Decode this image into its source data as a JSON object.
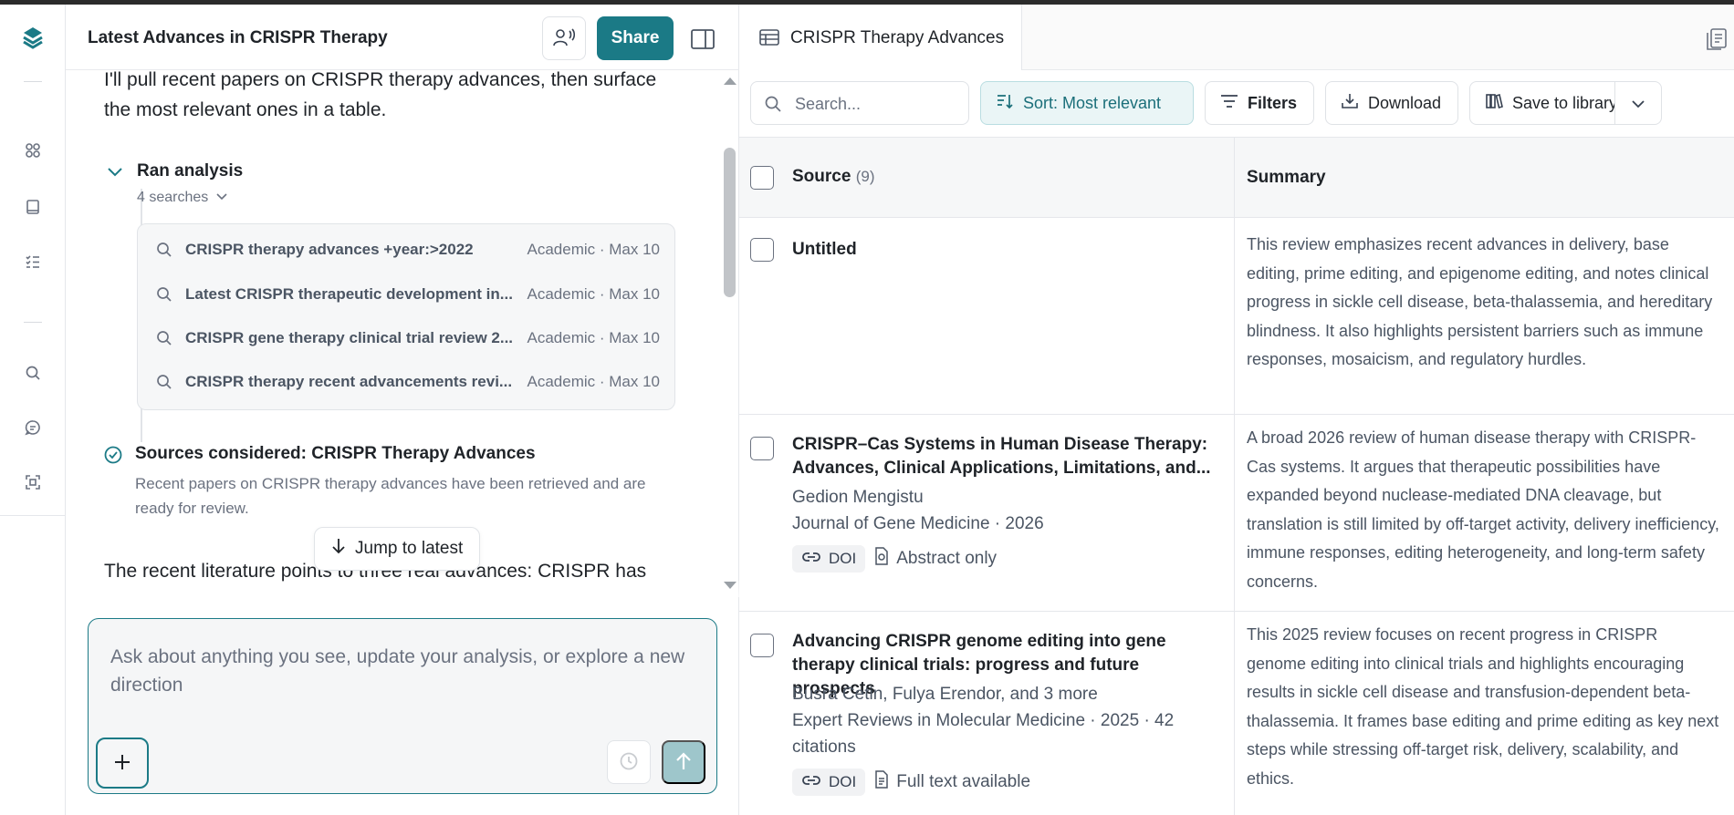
{
  "chat": {
    "title": "Latest Advances in CRISPR Therapy",
    "share_label": "Share",
    "intro": "I'll pull recent papers on CRISPR therapy advances, then surface the most relevant ones in a table.",
    "ran_label": "Ran analysis",
    "searches_label": "4 searches",
    "queries": [
      {
        "text": "CRISPR therapy advances +year:>2022",
        "meta": "Academic · Max 10"
      },
      {
        "text": "Latest CRISPR therapeutic development in...",
        "meta": "Academic · Max 10"
      },
      {
        "text": "CRISPR gene therapy clinical trial review 2...",
        "meta": "Academic · Max 10"
      },
      {
        "text": "CRISPR therapy recent advancements revi...",
        "meta": "Academic · Max 10"
      }
    ],
    "sources_title": "Sources considered: CRISPR Therapy Advances",
    "sources_desc": "Recent papers on CRISPR therapy advances have been retrieved and are ready for review.",
    "jump_label": "Jump to latest",
    "recent_text": "The recent literature points to three real advances: CRISPR has",
    "composer_placeholder": "Ask about anything you see, update your analysis, or explore a new direction"
  },
  "panel": {
    "tab_label": "CRISPR Therapy Advances",
    "search_placeholder": "Search...",
    "sort_label": "Sort: Most relevant",
    "filters_label": "Filters",
    "download_label": "Download",
    "save_label": "Save to library",
    "col_source": "Source",
    "col_source_count": "(9)",
    "col_summary": "Summary"
  },
  "rows": [
    {
      "title": "Untitled",
      "summary": "This review emphasizes recent advances in delivery, base editing, prime editing, and epigenome editing, and notes clinical progress in sickle cell disease, beta-thalassemia, and hereditary blindness. It also highlights persistent barriers such as immune responses, mosaicism, and regulatory hurdles."
    },
    {
      "title": "CRISPR–Cas Systems in Human Disease Therapy: Advances, Clinical Applications, Limitations, and...",
      "authors": "Gedion Mengistu",
      "venue": "Journal of Gene Medicine · 2026",
      "tag_doi": "DOI",
      "tag_access": "Abstract only",
      "summary": "A broad 2026 review of human disease therapy with CRISPR-Cas systems. It argues that therapeutic possibilities have expanded beyond nuclease-mediated DNA cleavage, but translation is still limited by off-target activity, delivery inefficiency, immune responses, editing heterogeneity, and long-term safety concerns."
    },
    {
      "title": "Advancing CRISPR genome editing into gene therapy clinical trials: progress and future prospects",
      "authors": "Busra Cetin, Fulya Erendor, and 3 more",
      "venue": "Expert Reviews in Molecular Medicine · 2025 · 42 citations",
      "tag_doi": "DOI",
      "tag_access": "Full text available",
      "summary": "This 2025 review focuses on recent progress in CRISPR genome editing into clinical trials and highlights encouraging results in sickle cell disease and transfusion-dependent beta-thalassemia. It frames base editing and prime editing as key next steps while stressing off-target risk, delivery, scalability, and ethics."
    }
  ],
  "colors": {
    "accent": "#1b7a86",
    "sort_bg": "#eaf5f6",
    "send_disabled": "#9ec6cb"
  },
  "icons": [
    "app-logo-icon",
    "grid-icon",
    "book-icon",
    "checklist-icon",
    "search-icon",
    "chat-icon",
    "scan-icon",
    "voice-icon",
    "panel-icon",
    "table-icon",
    "document-icon",
    "sort-icon",
    "filter-icon",
    "download-icon",
    "library-icon",
    "chevron-down-icon",
    "link-icon",
    "file-icon",
    "check-circle-icon",
    "arrow-down-icon",
    "plus-icon",
    "clock-icon",
    "arrow-up-icon"
  ]
}
